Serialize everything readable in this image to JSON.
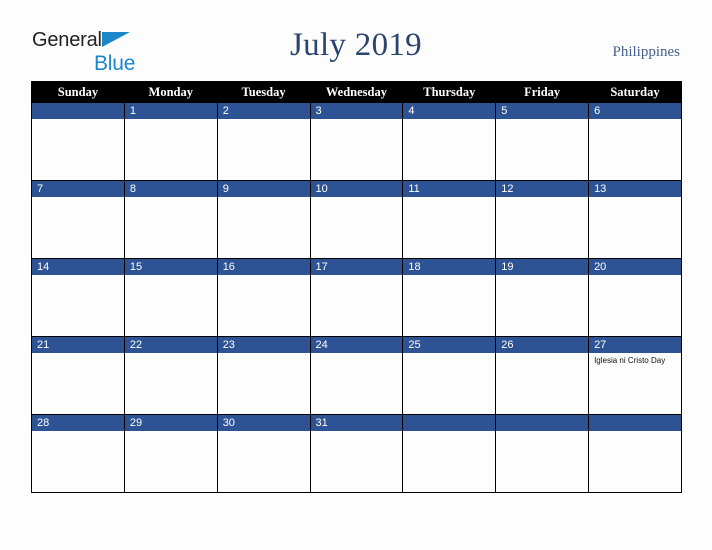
{
  "brand": {
    "name_part1": "General",
    "name_part2": "Blue",
    "triangle_color": "#1b86c8",
    "text_color": "#231f20"
  },
  "header": {
    "title": "July 2019",
    "country": "Philippines",
    "title_color": "#2b456f",
    "country_color": "#45608c"
  },
  "calendar": {
    "month": "July",
    "year": "2019",
    "weekday_headers": [
      "Sunday",
      "Monday",
      "Tuesday",
      "Wednesday",
      "Thursday",
      "Friday",
      "Saturday"
    ],
    "header_bg": "#000000",
    "header_text_color": "#ffffff",
    "daynum_band_color": "#2e5395",
    "daynum_text_color": "#ffffff",
    "cell_bg": "#fdfdfd",
    "grid_line_color": "#000000",
    "weeks": [
      [
        {
          "day": "",
          "events": []
        },
        {
          "day": "1",
          "events": []
        },
        {
          "day": "2",
          "events": []
        },
        {
          "day": "3",
          "events": []
        },
        {
          "day": "4",
          "events": []
        },
        {
          "day": "5",
          "events": []
        },
        {
          "day": "6",
          "events": []
        }
      ],
      [
        {
          "day": "7",
          "events": []
        },
        {
          "day": "8",
          "events": []
        },
        {
          "day": "9",
          "events": []
        },
        {
          "day": "10",
          "events": []
        },
        {
          "day": "11",
          "events": []
        },
        {
          "day": "12",
          "events": []
        },
        {
          "day": "13",
          "events": []
        }
      ],
      [
        {
          "day": "14",
          "events": []
        },
        {
          "day": "15",
          "events": []
        },
        {
          "day": "16",
          "events": []
        },
        {
          "day": "17",
          "events": []
        },
        {
          "day": "18",
          "events": []
        },
        {
          "day": "19",
          "events": []
        },
        {
          "day": "20",
          "events": []
        }
      ],
      [
        {
          "day": "21",
          "events": []
        },
        {
          "day": "22",
          "events": []
        },
        {
          "day": "23",
          "events": []
        },
        {
          "day": "24",
          "events": []
        },
        {
          "day": "25",
          "events": []
        },
        {
          "day": "26",
          "events": []
        },
        {
          "day": "27",
          "events": [
            "Iglesia ni Cristo Day"
          ]
        }
      ],
      [
        {
          "day": "28",
          "events": []
        },
        {
          "day": "29",
          "events": []
        },
        {
          "day": "30",
          "events": []
        },
        {
          "day": "31",
          "events": []
        },
        {
          "day": "",
          "events": []
        },
        {
          "day": "",
          "events": []
        },
        {
          "day": "",
          "events": []
        }
      ]
    ]
  }
}
